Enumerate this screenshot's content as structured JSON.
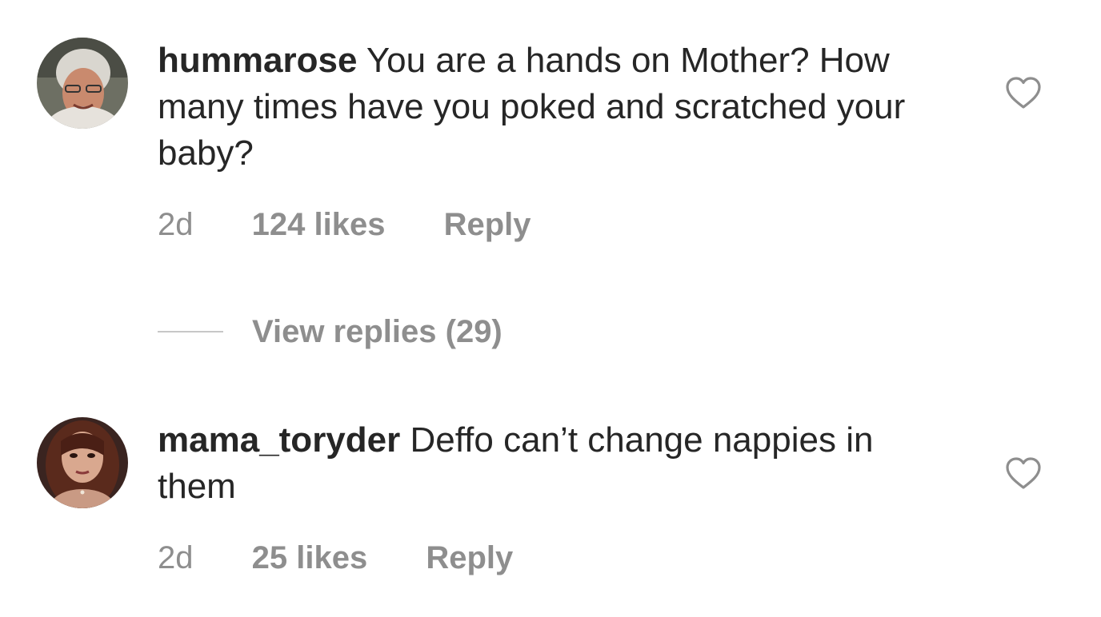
{
  "comments": [
    {
      "username": "hummarose",
      "text": "You are a hands on Mother? How many times have you poked and scratched your baby?",
      "time": "2d",
      "likes": "124 likes",
      "reply_label": "Reply",
      "liked": false,
      "avatar_icon": "user-avatar"
    },
    {
      "username": "mama_toryder",
      "text": "Deffo can’t change nappies in them",
      "time": "2d",
      "likes": "25 likes",
      "reply_label": "Reply",
      "liked": false,
      "avatar_icon": "user-avatar"
    }
  ],
  "view_replies": {
    "label": "View replies (29)"
  },
  "colors": {
    "text": "#262626",
    "secondary": "#8e8e8e",
    "divider": "#c7c7c7",
    "background": "#ffffff"
  },
  "icons": {
    "like": "heart-outline-icon"
  }
}
